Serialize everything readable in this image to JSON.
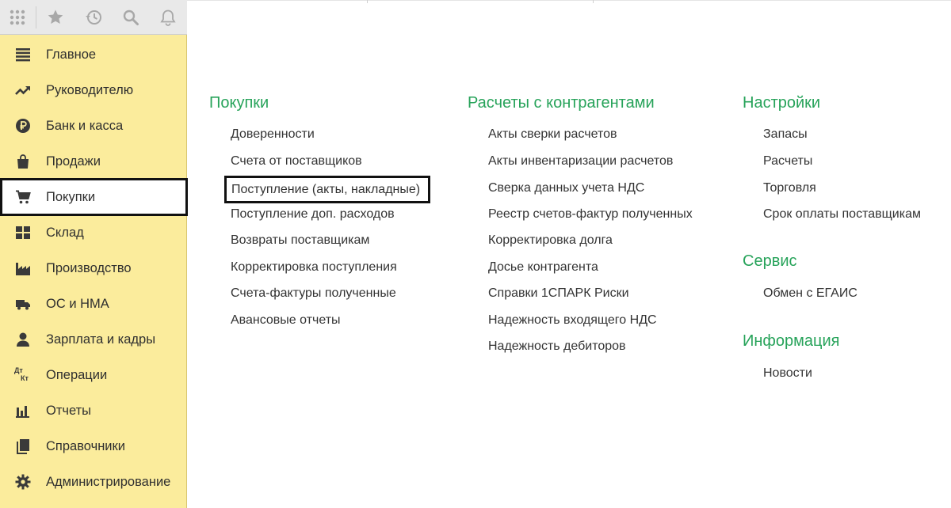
{
  "toolbar": {
    "icons": [
      "apps-grid-icon",
      "favorites-star-icon",
      "history-icon",
      "search-icon",
      "notifications-bell-icon"
    ]
  },
  "sidebar": {
    "items": [
      {
        "label": "Главное",
        "icon": "menu-lines-icon"
      },
      {
        "label": "Руководителю",
        "icon": "trend-up-icon"
      },
      {
        "label": "Банк и касса",
        "icon": "ruble-coin-icon"
      },
      {
        "label": "Продажи",
        "icon": "shopping-bag-icon"
      },
      {
        "label": "Покупки",
        "icon": "shopping-cart-icon",
        "active": true
      },
      {
        "label": "Склад",
        "icon": "warehouse-grid-icon"
      },
      {
        "label": "Производство",
        "icon": "factory-icon"
      },
      {
        "label": "ОС и НМА",
        "icon": "truck-icon"
      },
      {
        "label": "Зарплата и кадры",
        "icon": "person-icon"
      },
      {
        "label": "Операции",
        "icon": "debit-credit-icon",
        "icon_text": [
          "Дт",
          "Кт"
        ]
      },
      {
        "label": "Отчеты",
        "icon": "bar-chart-icon"
      },
      {
        "label": "Справочники",
        "icon": "books-icon"
      },
      {
        "label": "Администрирование",
        "icon": "gear-icon"
      }
    ]
  },
  "main": {
    "columns": [
      {
        "sections": [
          {
            "title": "Покупки",
            "links": [
              "Доверенности",
              "Счета от поставщиков",
              "Поступление (акты, накладные)",
              "Поступление доп. расходов",
              "Возвраты поставщикам",
              "Корректировка поступления",
              "Счета-фактуры полученные",
              "Авансовые отчеты"
            ],
            "active_link": "Поступление (акты, накладные)"
          }
        ]
      },
      {
        "sections": [
          {
            "title": "Расчеты с контрагентами",
            "links": [
              "Акты сверки расчетов",
              "Акты инвентаризации расчетов",
              "Сверка данных учета НДС",
              "Реестр счетов-фактур полученных",
              "Корректировка долга",
              "Досье контрагента",
              "Справки 1СПАРК Риски",
              "Надежность входящего НДС",
              "Надежность дебиторов"
            ]
          }
        ]
      },
      {
        "sections": [
          {
            "title": "Настройки",
            "links": [
              "Запасы",
              "Расчеты",
              "Торговля",
              "Срок оплаты поставщикам"
            ]
          },
          {
            "title": "Сервис",
            "links": [
              "Обмен с ЕГАИС"
            ]
          },
          {
            "title": "Информация",
            "links": [
              "Новости"
            ]
          }
        ]
      }
    ]
  },
  "colors": {
    "sidebar_bg": "#fbec9c",
    "section_title": "#27a35a",
    "toolbar_bg": "#e9e9e9",
    "highlight_border": "#111111"
  }
}
